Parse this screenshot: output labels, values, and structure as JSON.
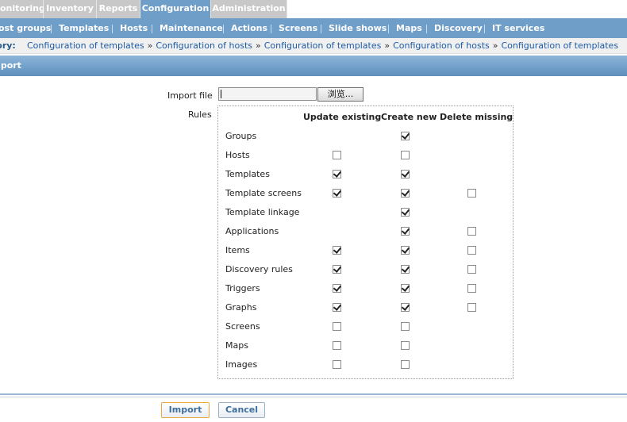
{
  "top_menu": {
    "items": [
      {
        "label": "onitoring"
      },
      {
        "label": "Inventory"
      },
      {
        "label": "Reports"
      },
      {
        "label": "Configuration",
        "active": true
      },
      {
        "label": "Administration"
      }
    ]
  },
  "sub_menu": {
    "items": [
      {
        "label": "ost groups"
      },
      {
        "label": "Templates"
      },
      {
        "label": "Hosts"
      },
      {
        "label": "Maintenance"
      },
      {
        "label": "Actions"
      },
      {
        "label": "Screens"
      },
      {
        "label": "Slide shows"
      },
      {
        "label": "Maps"
      },
      {
        "label": "Discovery"
      },
      {
        "label": "IT services"
      }
    ]
  },
  "history": {
    "label": "tory:",
    "items": [
      "Configuration of templates",
      "Configuration of hosts",
      "Configuration of templates",
      "Configuration of hosts",
      "Configuration of templates"
    ],
    "separator": "»"
  },
  "section": {
    "title": "nport"
  },
  "form": {
    "import_file_label": "Import file",
    "browse_button": "浏览...",
    "rules_label": "Rules",
    "columns": [
      "Update existing",
      "Create new",
      "Delete missing"
    ],
    "rows": [
      {
        "label": "Groups",
        "update": null,
        "create": true,
        "delete": null
      },
      {
        "label": "Hosts",
        "update": false,
        "create": false,
        "delete": null
      },
      {
        "label": "Templates",
        "update": true,
        "create": true,
        "delete": null
      },
      {
        "label": "Template screens",
        "update": true,
        "create": true,
        "delete": false
      },
      {
        "label": "Template linkage",
        "update": null,
        "create": true,
        "delete": null
      },
      {
        "label": "Applications",
        "update": null,
        "create": true,
        "delete": false
      },
      {
        "label": "Items",
        "update": true,
        "create": true,
        "delete": false
      },
      {
        "label": "Discovery rules",
        "update": true,
        "create": true,
        "delete": false
      },
      {
        "label": "Triggers",
        "update": true,
        "create": true,
        "delete": false
      },
      {
        "label": "Graphs",
        "update": true,
        "create": true,
        "delete": false
      },
      {
        "label": "Screens",
        "update": false,
        "create": false,
        "delete": null
      },
      {
        "label": "Maps",
        "update": false,
        "create": false,
        "delete": null
      },
      {
        "label": "Images",
        "update": false,
        "create": false,
        "delete": null
      }
    ]
  },
  "footer": {
    "import_button": "Import",
    "cancel_button": "Cancel"
  },
  "colors": {
    "menu_active": "#6f9ec9",
    "menu_inactive": "#c8c8c8",
    "link": "#1b5aa7",
    "import_border": "#f0a640"
  }
}
